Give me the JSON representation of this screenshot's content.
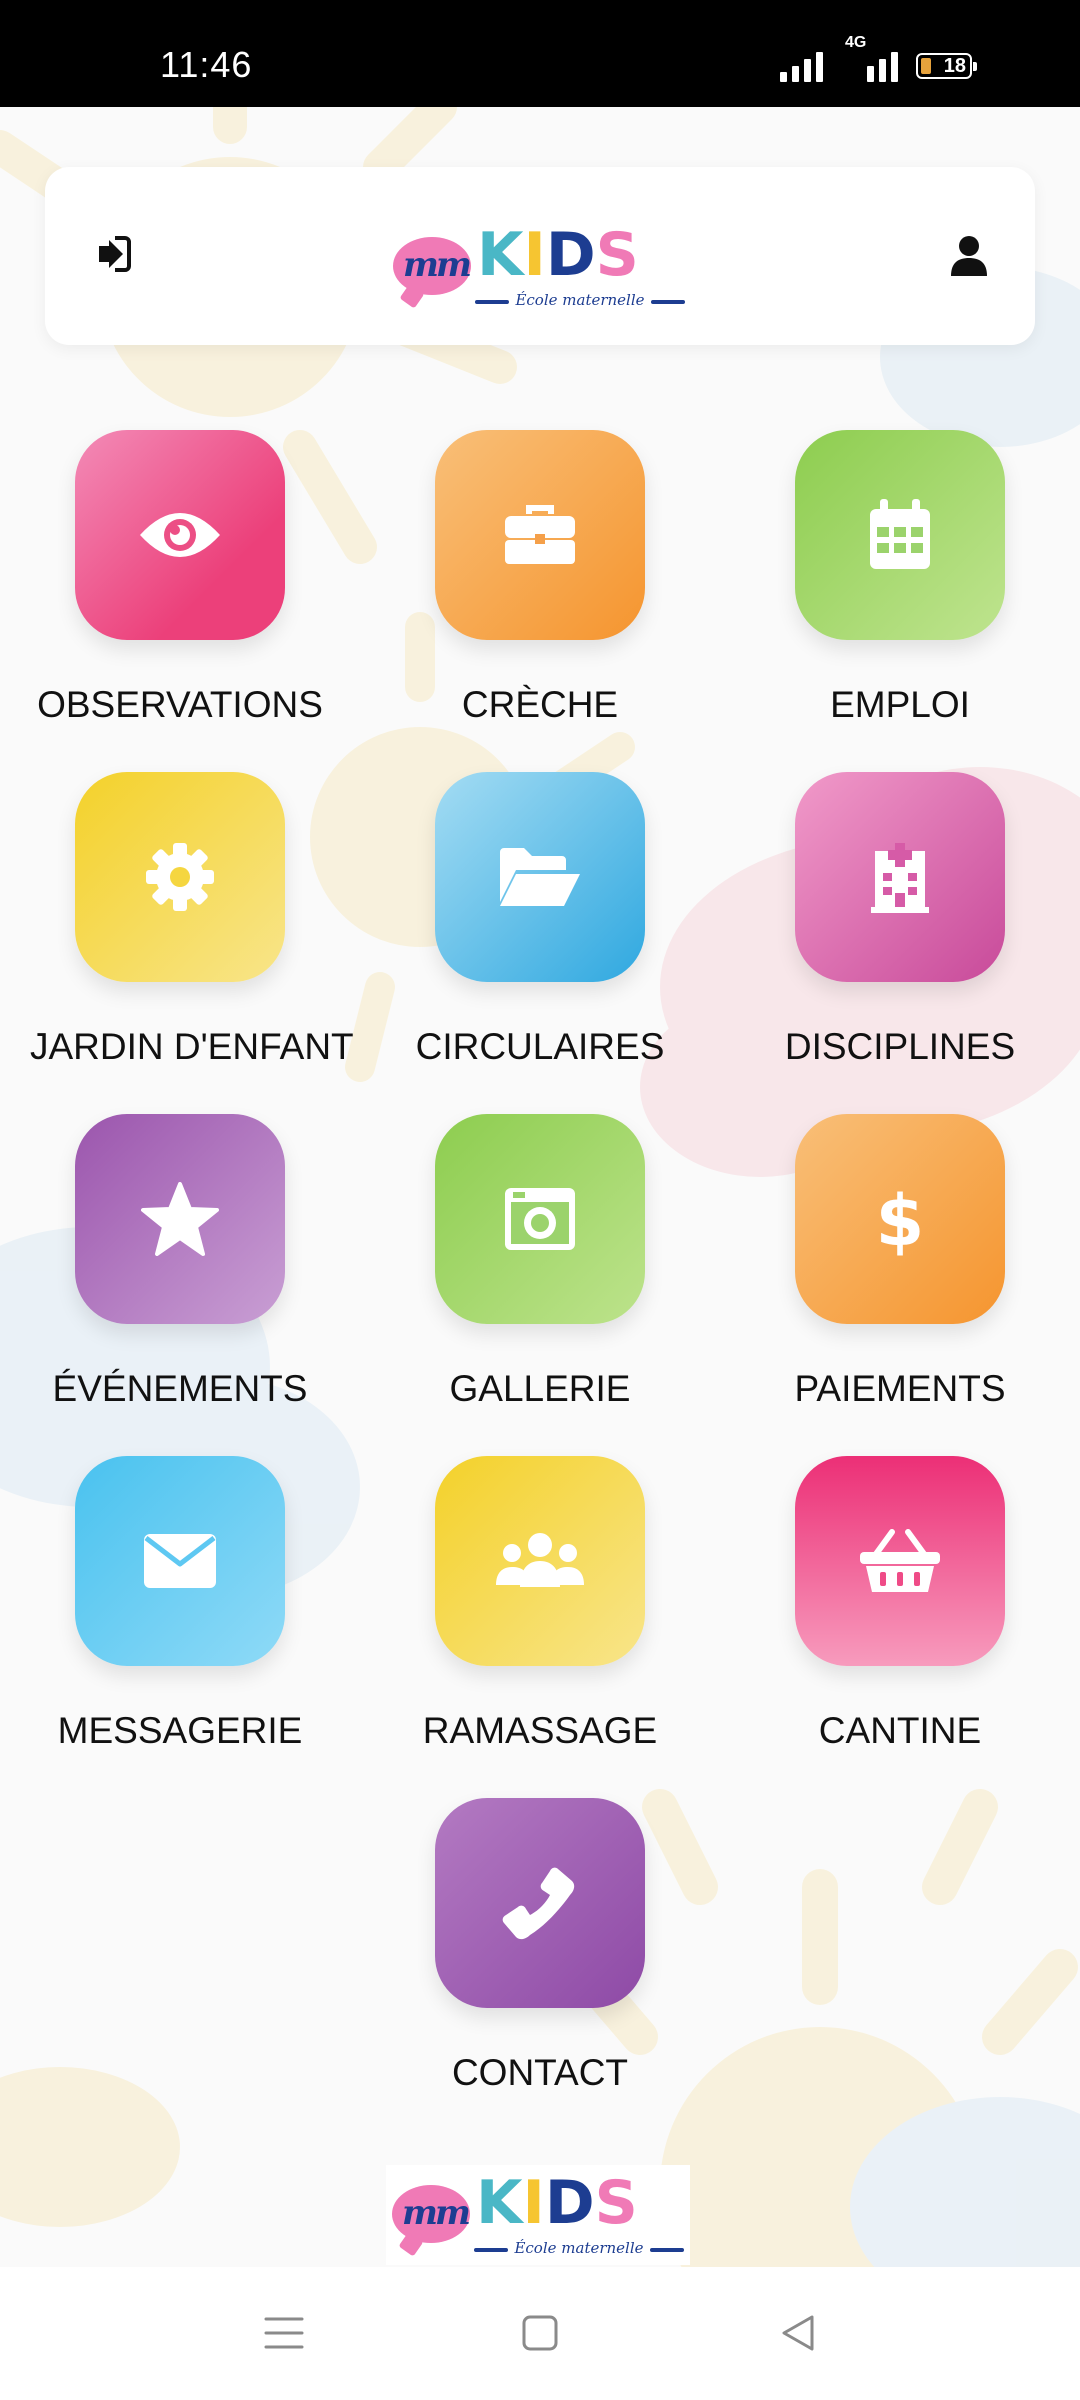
{
  "status_bar": {
    "time": "11:46",
    "network": "4G",
    "battery": "18"
  },
  "header": {
    "logo": {
      "brand": "KIDS",
      "tagline": "École maternelle"
    }
  },
  "tiles": [
    {
      "label": "OBSERVATIONS",
      "icon": "eye-icon",
      "color": "#ec407a"
    },
    {
      "label": "CRÈCHE",
      "icon": "briefcase-icon",
      "color": "#f5a04a"
    },
    {
      "label": "EMPLOI",
      "icon": "calendar-icon",
      "color": "#8fcd5b"
    },
    {
      "label": "JARDIN D'ENFANT",
      "icon": "gear-icon",
      "color": "#f6d63d"
    },
    {
      "label": "CIRCULAIRES",
      "icon": "folder-open-icon",
      "color": "#4db7e8"
    },
    {
      "label": "DISCIPLINES",
      "icon": "hospital-icon",
      "color": "#d65ba7"
    },
    {
      "label": "ÉVÉNEMENTS",
      "icon": "star-icon",
      "color": "#a668b7"
    },
    {
      "label": "GALLERIE",
      "icon": "camera-icon",
      "color": "#8fcd5b"
    },
    {
      "label": "PAIEMENTS",
      "icon": "dollar-icon",
      "color": "#f5a04a"
    },
    {
      "label": "MESSAGERIE",
      "icon": "envelope-icon",
      "color": "#5ec8f2"
    },
    {
      "label": "RAMASSAGE",
      "icon": "group-icon",
      "color": "#f6d63d"
    },
    {
      "label": "CANTINE",
      "icon": "basket-icon",
      "color": "#ee3d80"
    },
    {
      "label": "CONTACT",
      "icon": "phone-icon",
      "color": "#a45eb0"
    }
  ],
  "footer": {
    "logo": {
      "brand": "KIDS",
      "tagline": "École maternelle"
    }
  },
  "nav_bar": {
    "buttons": [
      "menu-icon",
      "home-square-icon",
      "back-triangle-icon"
    ]
  }
}
